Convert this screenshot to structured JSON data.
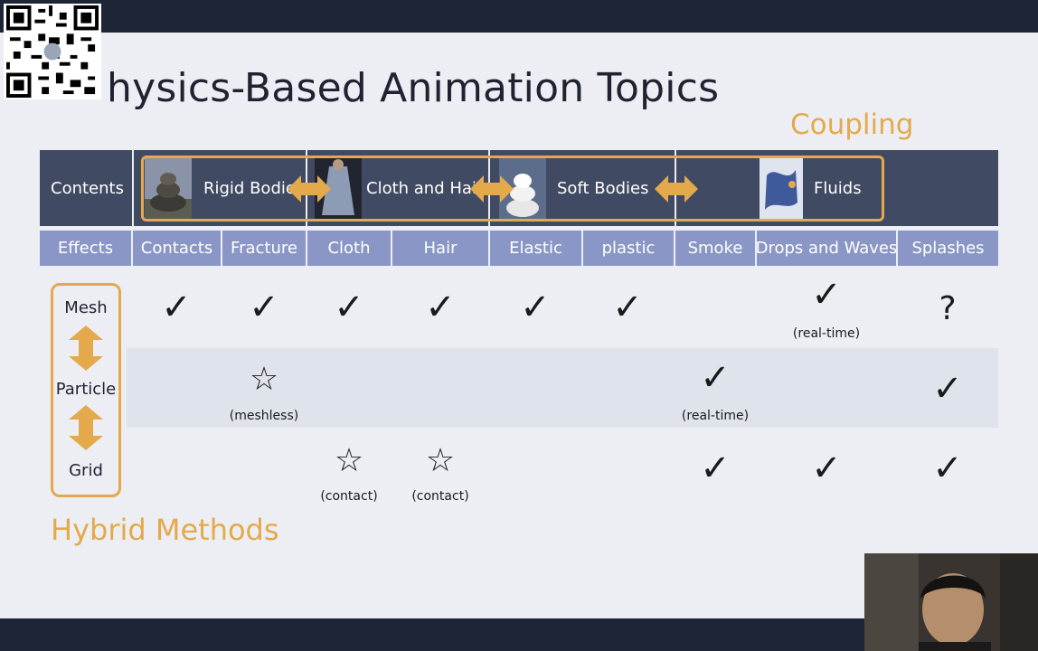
{
  "slide": {
    "title": "hysics-Based Animation Topics",
    "coupling_label": "Coupling",
    "hybrid_label": "Hybrid Methods"
  },
  "table": {
    "row1": {
      "label": "Contents",
      "groups": [
        "Rigid Bodie",
        "Cloth and Hai",
        "Soft Bodies",
        "Fluids"
      ]
    },
    "row2": [
      "Effects",
      "Contacts",
      "Fracture",
      "Cloth",
      "Hair",
      "Elastic",
      "plastic",
      "Smoke",
      "Drops and Waves",
      "Splashes"
    ],
    "methods": [
      "Mesh",
      "Particle",
      "Grid"
    ],
    "notes": {
      "mesh_drops": "(real-time)",
      "particle_fracture": "(meshless)",
      "particle_smoke": "(real-time)",
      "grid_cloth": "(contact)",
      "grid_hair": "(contact)"
    },
    "symbols": {
      "check": "✓",
      "star": "☆",
      "question": "?"
    }
  },
  "colors": {
    "accent": "#e4a94b",
    "header_dark": "#414a63",
    "header_light": "#8a97c6",
    "band": "#dfe3ec",
    "frame": "#1e2536"
  },
  "icons": [
    "qr-code-icon",
    "double-arrow-icon",
    "vertical-double-arrow-icon"
  ]
}
